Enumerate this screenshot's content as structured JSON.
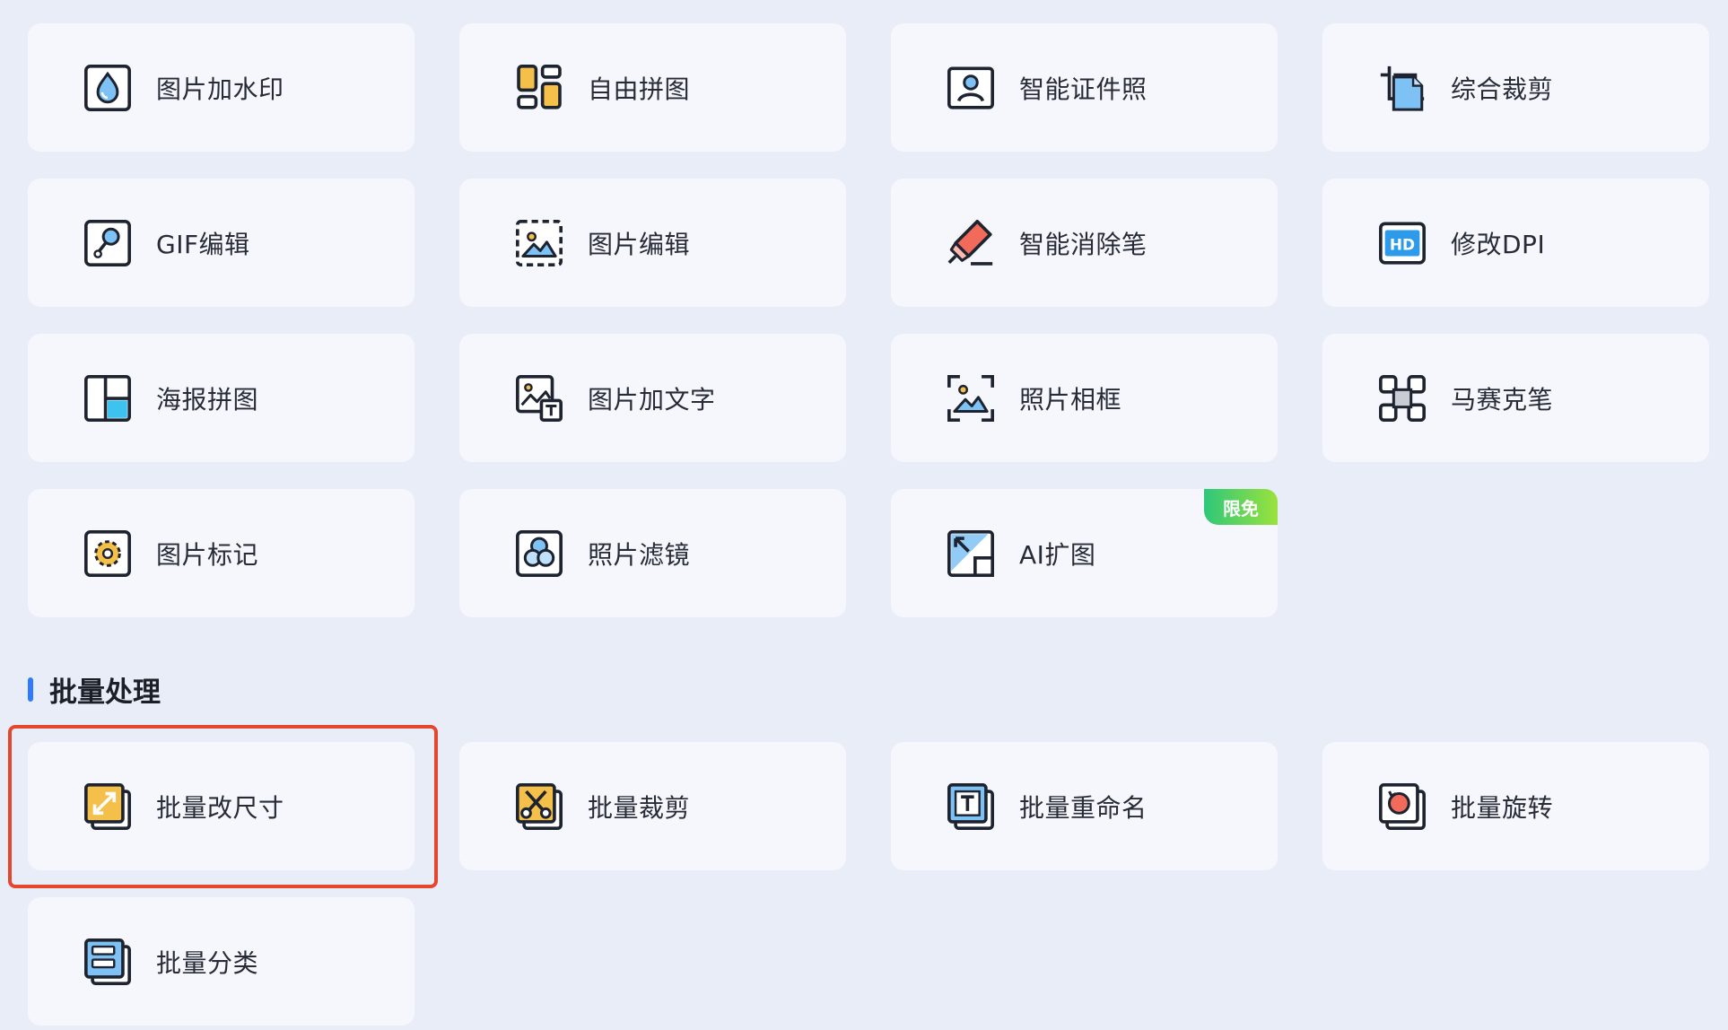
{
  "tools": [
    {
      "label": "图片加水印",
      "icon": "watermark-drop-icon"
    },
    {
      "label": "自由拼图",
      "icon": "free-collage-icon"
    },
    {
      "label": "智能证件照",
      "icon": "id-photo-icon"
    },
    {
      "label": "综合裁剪",
      "icon": "crop-icon"
    },
    {
      "label": "GIF编辑",
      "icon": "gif-edit-icon"
    },
    {
      "label": "图片编辑",
      "icon": "image-edit-icon"
    },
    {
      "label": "智能消除笔",
      "icon": "eraser-pen-icon"
    },
    {
      "label": "修改DPI",
      "icon": "hd-dpi-icon"
    },
    {
      "label": "海报拼图",
      "icon": "poster-collage-icon"
    },
    {
      "label": "图片加文字",
      "icon": "image-text-icon"
    },
    {
      "label": "照片相框",
      "icon": "photo-frame-icon"
    },
    {
      "label": "马赛克笔",
      "icon": "mosaic-pen-icon"
    },
    {
      "label": "图片标记",
      "icon": "image-mark-icon"
    },
    {
      "label": "照片滤镜",
      "icon": "photo-filter-icon"
    },
    {
      "label": "AI扩图",
      "icon": "ai-expand-icon",
      "badge": "限免"
    }
  ],
  "batch": {
    "title": "批量处理",
    "items": [
      {
        "label": "批量改尺寸",
        "icon": "batch-resize-icon"
      },
      {
        "label": "批量裁剪",
        "icon": "batch-crop-icon"
      },
      {
        "label": "批量重命名",
        "icon": "batch-rename-icon"
      },
      {
        "label": "批量旋转",
        "icon": "batch-rotate-icon"
      },
      {
        "label": "批量分类",
        "icon": "batch-classify-icon"
      }
    ]
  },
  "colors": {
    "background": "#e9edf8",
    "card": "#f5f7fc",
    "accent": "#2f7bff",
    "highlight": "#e6452e",
    "badge_start": "#2ec77a",
    "badge_end": "#9be23c"
  }
}
